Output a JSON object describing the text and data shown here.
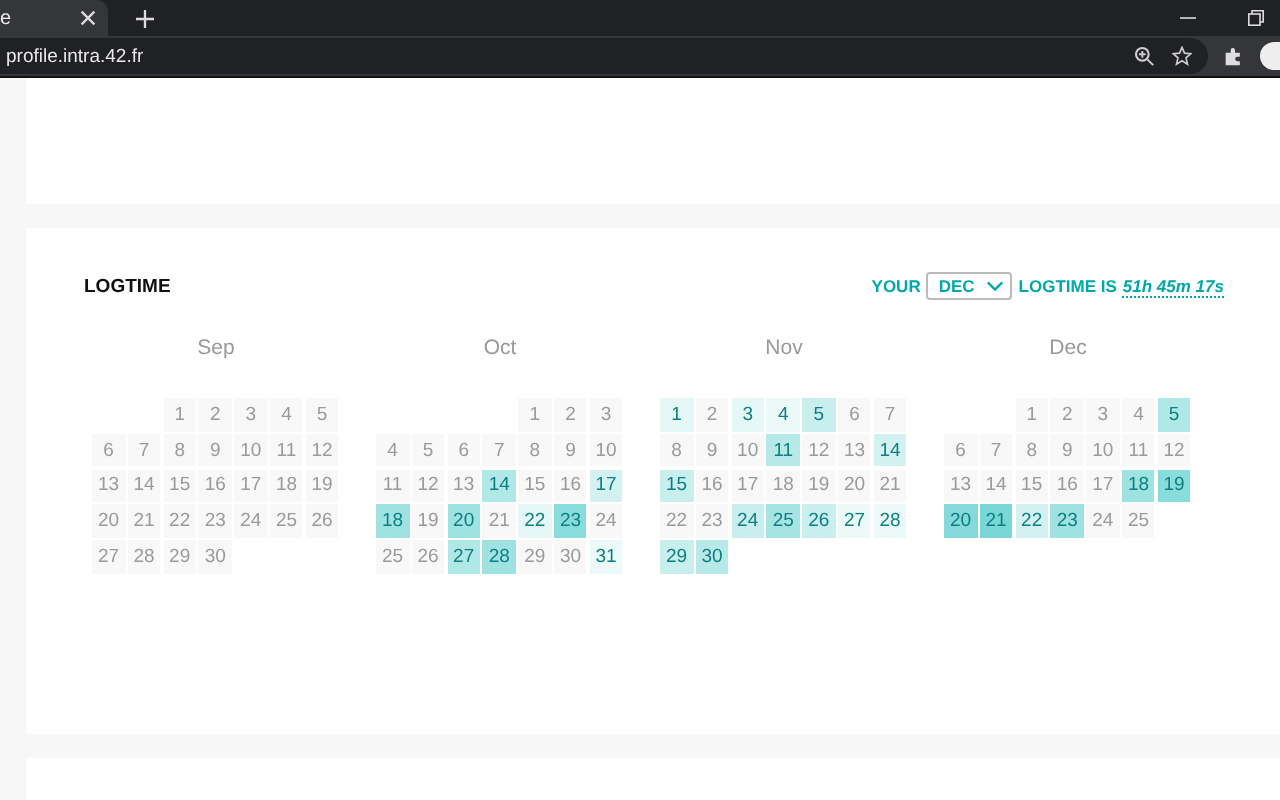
{
  "browser": {
    "tab_title": "e",
    "url": "profile.intra.42.fr"
  },
  "logtime": {
    "title": "LOGTIME",
    "summary_prefix": "YOUR",
    "month_select": "DEC",
    "summary_middle": "LOGTIME IS",
    "total": "51h 45m 17s",
    "months": [
      {
        "name": "Sep",
        "days": [
          {
            "kind": "blank"
          },
          {
            "kind": "blank"
          },
          {
            "day": "1"
          },
          {
            "day": "2"
          },
          {
            "day": "3"
          },
          {
            "day": "4"
          },
          {
            "day": "5"
          },
          {
            "day": "6"
          },
          {
            "day": "7"
          },
          {
            "day": "8"
          },
          {
            "day": "9"
          },
          {
            "day": "10"
          },
          {
            "day": "11"
          },
          {
            "day": "12"
          },
          {
            "day": "13"
          },
          {
            "day": "14"
          },
          {
            "day": "15"
          },
          {
            "day": "16"
          },
          {
            "day": "17"
          },
          {
            "day": "18"
          },
          {
            "day": "19"
          },
          {
            "day": "20"
          },
          {
            "day": "21"
          },
          {
            "day": "22"
          },
          {
            "day": "23"
          },
          {
            "day": "24"
          },
          {
            "day": "25"
          },
          {
            "day": "26"
          },
          {
            "day": "27"
          },
          {
            "day": "28"
          },
          {
            "day": "29"
          },
          {
            "day": "30"
          }
        ]
      },
      {
        "name": "Oct",
        "days": [
          {
            "kind": "blank"
          },
          {
            "kind": "blank"
          },
          {
            "kind": "blank"
          },
          {
            "kind": "blank"
          },
          {
            "day": "1"
          },
          {
            "day": "2"
          },
          {
            "day": "3"
          },
          {
            "day": "4"
          },
          {
            "day": "5"
          },
          {
            "day": "6"
          },
          {
            "day": "7"
          },
          {
            "day": "8"
          },
          {
            "day": "9"
          },
          {
            "day": "10"
          },
          {
            "day": "11"
          },
          {
            "day": "12"
          },
          {
            "day": "13"
          },
          {
            "day": "14",
            "color": "#b0e7e7"
          },
          {
            "day": "15"
          },
          {
            "day": "16"
          },
          {
            "day": "17",
            "color": "#d4f1f1"
          },
          {
            "day": "18",
            "color": "#9ee2e2"
          },
          {
            "day": "19"
          },
          {
            "day": "20",
            "color": "#9ee2e2"
          },
          {
            "day": "21"
          },
          {
            "day": "22",
            "color": "#e6f7f7"
          },
          {
            "day": "23",
            "color": "#88dcdc"
          },
          {
            "day": "24"
          },
          {
            "day": "25"
          },
          {
            "day": "26"
          },
          {
            "day": "27",
            "color": "#b0e7e7"
          },
          {
            "day": "28",
            "color": "#9ee2e2"
          },
          {
            "day": "29"
          },
          {
            "day": "30"
          },
          {
            "day": "31",
            "color": "#ecf9f9"
          }
        ]
      },
      {
        "name": "Nov",
        "days": [
          {
            "day": "1",
            "color": "#e6f7f7"
          },
          {
            "day": "2"
          },
          {
            "day": "3",
            "color": "#e6f7f7"
          },
          {
            "day": "4",
            "color": "#ecf9f9"
          },
          {
            "day": "5",
            "color": "#c8eeee"
          },
          {
            "day": "6"
          },
          {
            "day": "7"
          },
          {
            "day": "8"
          },
          {
            "day": "9"
          },
          {
            "day": "10"
          },
          {
            "day": "11",
            "color": "#b8e9e9"
          },
          {
            "day": "12"
          },
          {
            "day": "13"
          },
          {
            "day": "14",
            "color": "#d4f1f1"
          },
          {
            "day": "15",
            "color": "#c8eeee"
          },
          {
            "day": "16"
          },
          {
            "day": "17"
          },
          {
            "day": "18"
          },
          {
            "day": "19"
          },
          {
            "day": "20"
          },
          {
            "day": "21"
          },
          {
            "day": "22"
          },
          {
            "day": "23"
          },
          {
            "day": "24",
            "color": "#c8eeee"
          },
          {
            "day": "25",
            "color": "#a6e4e4"
          },
          {
            "day": "26",
            "color": "#c8eeee"
          },
          {
            "day": "27",
            "color": "#ecf9f9"
          },
          {
            "day": "28",
            "color": "#ecf9f9"
          },
          {
            "day": "29",
            "color": "#c8eeee"
          },
          {
            "day": "30",
            "color": "#b8e9e9"
          }
        ]
      },
      {
        "name": "Dec",
        "days": [
          {
            "kind": "blank"
          },
          {
            "kind": "blank"
          },
          {
            "day": "1"
          },
          {
            "day": "2"
          },
          {
            "day": "3"
          },
          {
            "day": "4"
          },
          {
            "day": "5",
            "color": "#b0e7e7"
          },
          {
            "day": "6"
          },
          {
            "day": "7"
          },
          {
            "day": "8"
          },
          {
            "day": "9"
          },
          {
            "day": "10"
          },
          {
            "day": "11"
          },
          {
            "day": "12"
          },
          {
            "day": "13"
          },
          {
            "day": "14"
          },
          {
            "day": "15"
          },
          {
            "day": "16"
          },
          {
            "day": "17"
          },
          {
            "day": "18",
            "color": "#9ee2e2"
          },
          {
            "day": "19",
            "color": "#88dcdc"
          },
          {
            "day": "20",
            "color": "#84dada"
          },
          {
            "day": "21",
            "color": "#7ad7d7"
          },
          {
            "day": "22",
            "color": "#d4f1f1"
          },
          {
            "day": "23",
            "color": "#9ee2e2"
          },
          {
            "day": "24"
          },
          {
            "day": "25"
          }
        ]
      }
    ]
  }
}
